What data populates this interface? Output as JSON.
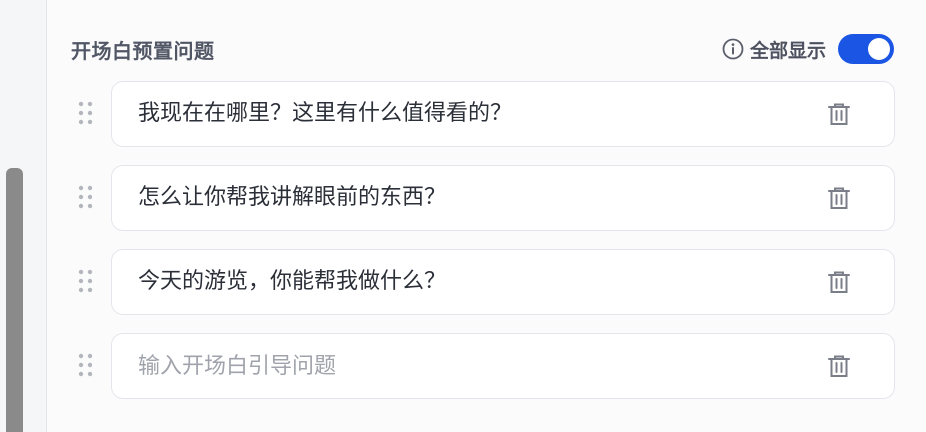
{
  "section": {
    "title": "开场白预置问题",
    "show_all_label": "全部显示",
    "show_all_enabled": true
  },
  "questions": [
    {
      "text": "我现在在哪里？这里有什么值得看的？"
    },
    {
      "text": "怎么让你帮我讲解眼前的东西？"
    },
    {
      "text": "今天的游览，你能帮我做什么？"
    }
  ],
  "new_question": {
    "value": "",
    "placeholder": "输入开场白引导问题"
  },
  "icons": {
    "info": "info-circle-icon",
    "drag": "drag-handle-icon",
    "delete": "trash-icon"
  },
  "colors": {
    "accent": "#1a55e3",
    "title": "#525766",
    "text": "#2b2f38",
    "placeholder": "#a0a3ab",
    "icon": "#7a7e88"
  }
}
